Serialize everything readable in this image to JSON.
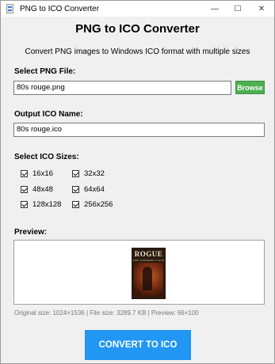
{
  "window": {
    "title": "PNG to ICO Converter",
    "controls": {
      "minimize": "—",
      "maximize": "☐",
      "close": "✕"
    }
  },
  "header": {
    "title": "PNG to ICO Converter",
    "subtitle": "Convert PNG images to Windows ICO format with multiple sizes"
  },
  "png_file": {
    "label": "Select PNG File:",
    "value": "80s rouge.png",
    "browse_label": "Browse"
  },
  "output": {
    "label": "Output ICO Name:",
    "value": "80s rouge.ico"
  },
  "sizes": {
    "label": "Select ICO Sizes:",
    "options": [
      {
        "label": "16x16",
        "checked": true
      },
      {
        "label": "32x32",
        "checked": true
      },
      {
        "label": "48x48",
        "checked": true
      },
      {
        "label": "64x64",
        "checked": true
      },
      {
        "label": "128x128",
        "checked": true
      },
      {
        "label": "256x256",
        "checked": true
      }
    ]
  },
  "preview": {
    "label": "Preview:",
    "image_title": "ROGUE",
    "image_subtitle": "THE WARRIOR'S TALE",
    "info": "Original size: 1024×1536 | File size: 3289.7 KB | Preview: 66×100"
  },
  "convert_label": "CONVERT TO ICO",
  "colors": {
    "browse_bg": "#4caf50",
    "convert_bg": "#2196f3",
    "window_bg": "#f0f0f0"
  }
}
